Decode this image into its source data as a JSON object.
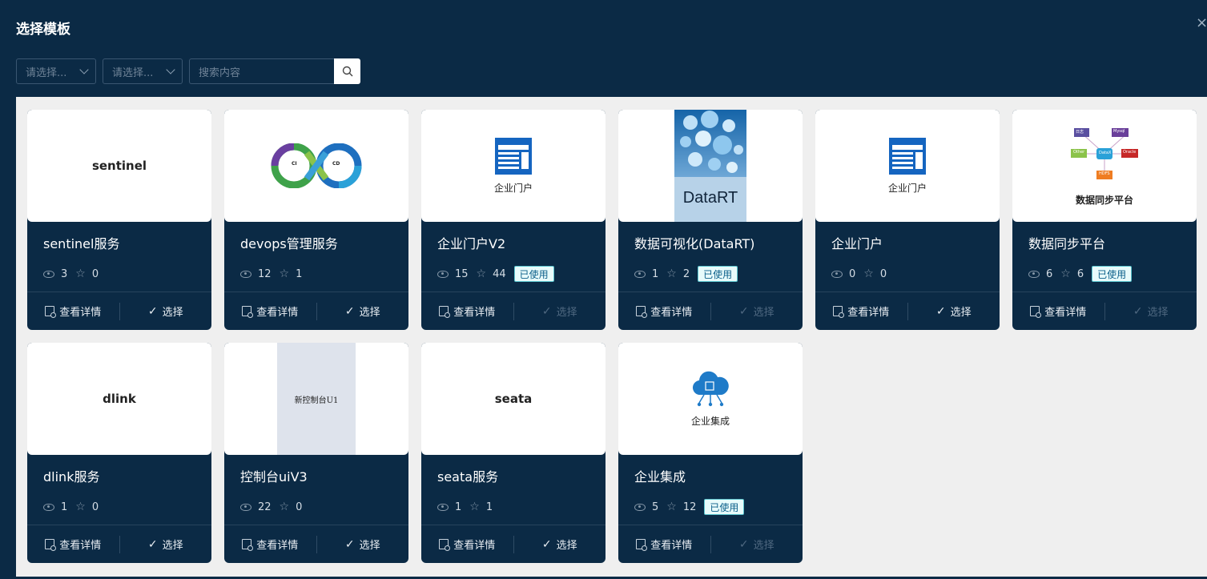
{
  "dialog": {
    "title": "选择模板",
    "close_icon": "×"
  },
  "filters": {
    "select1_placeholder": "请选择...",
    "select2_placeholder": "请选择...",
    "search_placeholder": "搜索内容"
  },
  "actions": {
    "detail_label": "查看详情",
    "select_label": "选择"
  },
  "badge_used": "已使用",
  "cards": [
    {
      "name": "sentinel服务",
      "views": "3",
      "stars": "0",
      "used": false,
      "thumb_text": "sentinel"
    },
    {
      "name": "devops管理服务",
      "views": "12",
      "stars": "1",
      "used": false,
      "thumb_ci": "CI",
      "thumb_cd": "CD"
    },
    {
      "name": "企业门户V2",
      "views": "15",
      "stars": "44",
      "used": true,
      "thumb_text": "企业门户"
    },
    {
      "name": "数据可视化(DataRT)",
      "views": "1",
      "stars": "2",
      "used": true,
      "thumb_text": "DataRT"
    },
    {
      "name": "企业门户",
      "views": "0",
      "stars": "0",
      "used": false,
      "thumb_text": "企业门户"
    },
    {
      "name": "数据同步平台",
      "views": "6",
      "stars": "6",
      "used": true,
      "thumb_text": "数据同步平台",
      "nodes": [
        "日志",
        "Mysql",
        "Other",
        "DataX",
        "Oracle",
        "HDFS"
      ]
    },
    {
      "name": "dlink服务",
      "views": "1",
      "stars": "0",
      "used": false,
      "thumb_text": "dlink"
    },
    {
      "name": "控制台uiV3",
      "views": "22",
      "stars": "0",
      "used": false,
      "thumb_text": "新控制台U1"
    },
    {
      "name": "seata服务",
      "views": "1",
      "stars": "1",
      "used": false,
      "thumb_text": "seata"
    },
    {
      "name": "企业集成",
      "views": "5",
      "stars": "12",
      "used": true,
      "thumb_text": "企业集成"
    }
  ]
}
